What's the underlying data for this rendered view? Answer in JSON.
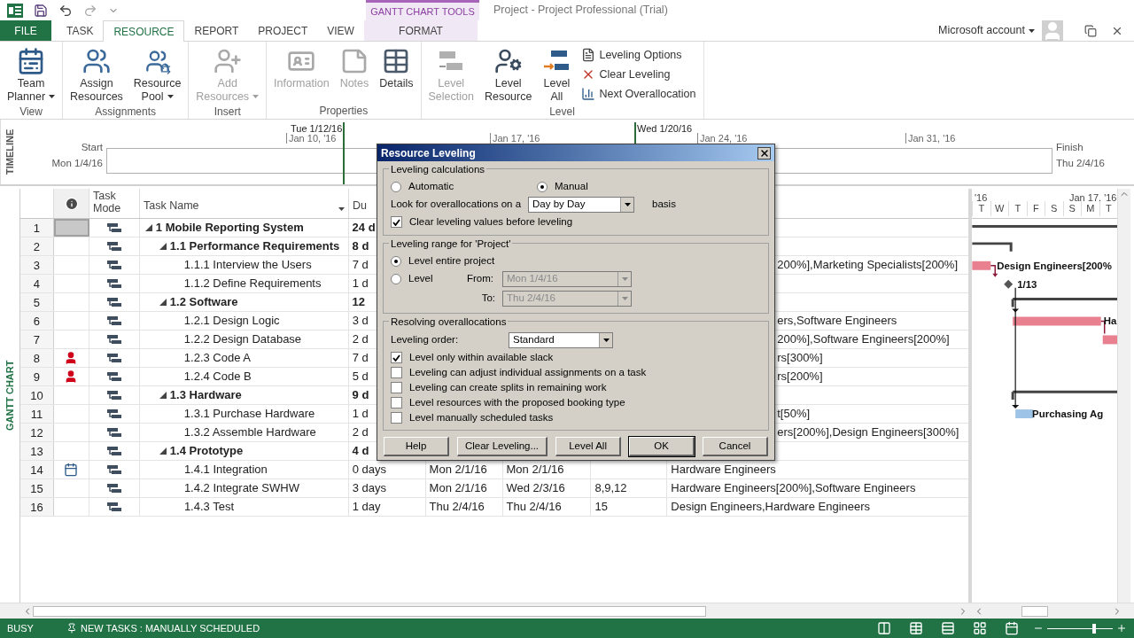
{
  "app": {
    "title": "Project - Project Professional (Trial)",
    "context_group": "GANTT CHART TOOLS",
    "account": "Microsoft account"
  },
  "tabs": [
    {
      "label": "FILE",
      "kind": "file",
      "selected": false
    },
    {
      "label": "TASK",
      "kind": "tab",
      "selected": false
    },
    {
      "label": "RESOURCE",
      "kind": "tab",
      "selected": true
    },
    {
      "label": "REPORT",
      "kind": "tab",
      "selected": false
    },
    {
      "label": "PROJECT",
      "kind": "tab",
      "selected": false
    },
    {
      "label": "VIEW",
      "kind": "tab",
      "selected": false
    },
    {
      "label": "FORMAT",
      "kind": "context",
      "selected": false
    }
  ],
  "ribbon": {
    "groups": [
      {
        "name": "View",
        "items": [
          {
            "lines": [
              "Team",
              "Planner"
            ],
            "kind": "large",
            "dropdown": true,
            "disabled": false
          }
        ]
      },
      {
        "name": "Assignments",
        "items": [
          {
            "lines": [
              "Assign",
              "Resources"
            ],
            "kind": "large",
            "dropdown": false,
            "disabled": false
          },
          {
            "lines": [
              "Resource",
              "Pool"
            ],
            "kind": "large",
            "dropdown": true,
            "disabled": false
          }
        ]
      },
      {
        "name": "Insert",
        "items": [
          {
            "lines": [
              "Add",
              "Resources"
            ],
            "kind": "large",
            "dropdown": true,
            "disabled": true
          }
        ]
      },
      {
        "name": "Properties",
        "items": [
          {
            "lines": [
              "Information"
            ],
            "kind": "large",
            "dropdown": false,
            "disabled": true
          },
          {
            "lines": [
              "Notes"
            ],
            "kind": "large",
            "dropdown": false,
            "disabled": true
          },
          {
            "lines": [
              "Details"
            ],
            "kind": "large",
            "dropdown": false,
            "disabled": false
          }
        ]
      },
      {
        "name": "Level",
        "items": [
          {
            "lines": [
              "Level",
              "Selection"
            ],
            "kind": "large",
            "dropdown": false,
            "disabled": true
          },
          {
            "lines": [
              "Level",
              "Resource"
            ],
            "kind": "large",
            "dropdown": false,
            "disabled": false
          },
          {
            "lines": [
              "Level",
              "All"
            ],
            "kind": "large",
            "dropdown": false,
            "disabled": false
          },
          {
            "lines": [
              "Leveling Options"
            ],
            "kind": "small",
            "dropdown": false,
            "disabled": false
          },
          {
            "lines": [
              "Clear Leveling"
            ],
            "kind": "small",
            "dropdown": false,
            "disabled": false
          },
          {
            "lines": [
              "Next Overallocation"
            ],
            "kind": "small",
            "dropdown": false,
            "disabled": false
          }
        ]
      }
    ]
  },
  "timeline": {
    "label": "TIMELINE",
    "start_label": "Start",
    "start_date": "Mon 1/4/16",
    "finish_label": "Finish",
    "finish_date": "Thu 2/4/16",
    "callouts": [
      "Tue 1/12/16",
      "Wed 1/20/16"
    ],
    "ticks": [
      "Jan 10, '16",
      "Jan 17, '16",
      "Jan 24, '16",
      "Jan 31, '16"
    ]
  },
  "table": {
    "side_label": "GANTT CHART",
    "columns": [
      {
        "label": "Task Mode"
      },
      {
        "label": "Task Name"
      },
      {
        "label": "Du"
      }
    ],
    "tasks": [
      {
        "id": "1",
        "name": "1 Mobile Reporting System",
        "selected": true,
        "expanded": true,
        "duration": "24 d",
        "children": [
          {
            "id": "2",
            "name": "1.1 Performance Requirements",
            "selected": false,
            "expanded": true,
            "duration": "8 d",
            "children": [
              {
                "id": "3",
                "name": "1.1.1 Interview the Users",
                "selected": false,
                "duration": "7 d",
                "resources": "200%],Marketing Specialists[200%]",
                "bar_label": "Design Engineers[200%"
              },
              {
                "id": "4",
                "name": "1.1.2 Define Requirements",
                "selected": false,
                "duration": "1 d",
                "bar_label": "1/13"
              }
            ]
          },
          {
            "id": "5",
            "name": "1.2 Software",
            "selected": false,
            "expanded": true,
            "duration": "12",
            "children": [
              {
                "id": "6",
                "name": "1.2.1 Design Logic",
                "selected": false,
                "duration": "3 d",
                "resources": "ers,Software Engineers",
                "bar_label": "Ha"
              },
              {
                "id": "7",
                "name": "1.2.2 Design Database",
                "selected": false,
                "duration": "2 d",
                "resources": "200%],Software Engineers[200%]"
              },
              {
                "id": "8",
                "name": "1.2.3 Code A",
                "kind": "overallocated",
                "selected": false,
                "duration": "7 d",
                "resources": "rs[300%]"
              },
              {
                "id": "9",
                "name": "1.2.4 Code B",
                "kind": "overallocated",
                "selected": false,
                "duration": "5 d",
                "resources": "rs[200%]"
              }
            ]
          },
          {
            "id": "10",
            "name": "1.3 Hardware",
            "selected": false,
            "expanded": true,
            "duration": "9 d",
            "children": [
              {
                "id": "11",
                "name": "1.3.1 Purchase Hardware",
                "selected": false,
                "duration": "1 d",
                "resources": "t[50%]",
                "bar_label": "Purchasing Ag"
              },
              {
                "id": "12",
                "name": "1.3.2 Assemble Hardware",
                "selected": false,
                "duration": "2 d",
                "resources": "ers[200%],Design Engineers[300%]"
              }
            ]
          },
          {
            "id": "13",
            "name": "1.4 Prototype",
            "selected": false,
            "expanded": true,
            "duration": "4 d",
            "children": [
              {
                "id": "14",
                "name": "1.4.1 Integration",
                "kind": "constraint",
                "selected": false,
                "duration": "0 days",
                "start": "Mon 2/1/16",
                "finish": "Mon 2/1/16",
                "resources": "Hardware Engineers"
              },
              {
                "id": "15",
                "name": "1.4.2 Integrate SWHW",
                "selected": false,
                "duration": "3 days",
                "start": "Mon 2/1/16",
                "finish": "Wed 2/3/16",
                "predecessors": "8,9,12",
                "resources": "Hardware Engineers[200%],Software Engineers"
              },
              {
                "id": "16",
                "name": "1.4.3 Test",
                "selected": false,
                "duration": "1 day",
                "start": "Thu 2/4/16",
                "finish": "Thu 2/4/16",
                "predecessors": "15",
                "resources": "Design Engineers,Hardware Engineers"
              }
            ]
          }
        ]
      }
    ]
  },
  "gantt": {
    "header": [
      "'16",
      "Jan 17, '16"
    ],
    "days": [
      "T",
      "W",
      "T",
      "F",
      "S",
      "S",
      "M",
      "T"
    ]
  },
  "dialog": {
    "title": "Resource Leveling",
    "calc": {
      "legend": "Leveling calculations",
      "modes": [
        {
          "label": "Automatic",
          "selected": false
        },
        {
          "label": "Manual",
          "selected": true
        }
      ],
      "look_label": "Look for overallocations on a",
      "basis": "Day by Day",
      "basis_suffix": "basis",
      "clear_values": {
        "label": "Clear leveling values before leveling",
        "checked": true
      }
    },
    "range": {
      "legend": "Leveling range for 'Project'",
      "options": [
        {
          "label": "Level entire project",
          "selected": true
        },
        {
          "label": "Level",
          "selected": false
        }
      ],
      "from_label": "From:",
      "from": "Mon 1/4/16",
      "to_label": "To:",
      "to": "Thu 2/4/16",
      "disabled": true
    },
    "resolving": {
      "legend": "Resolving overallocations",
      "order_label": "Leveling order:",
      "order": "Standard",
      "options": [
        {
          "label": "Level only within available slack",
          "checked": true
        },
        {
          "label": "Leveling can adjust individual assignments on a task",
          "checked": false
        },
        {
          "label": "Leveling can create splits in remaining work",
          "checked": false
        },
        {
          "label": "Level resources with the proposed booking type",
          "checked": false
        },
        {
          "label": "Level manually scheduled tasks",
          "checked": false
        }
      ]
    },
    "buttons": [
      {
        "label": "Help",
        "default": false
      },
      {
        "label": "Clear Leveling...",
        "default": false
      },
      {
        "label": "Level All",
        "default": false
      },
      {
        "label": "OK",
        "default": true
      },
      {
        "label": "Cancel",
        "default": false
      }
    ]
  },
  "status": {
    "mode": "BUSY",
    "new_tasks": "NEW TASKS : MANUALLY SCHEDULED",
    "zoom": {
      "level": 0.72
    }
  }
}
